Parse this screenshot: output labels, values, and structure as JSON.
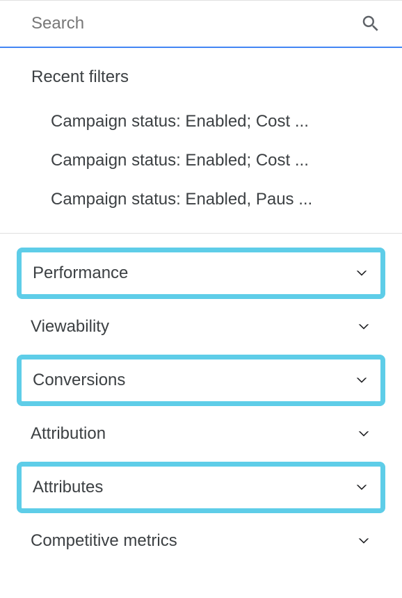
{
  "search": {
    "placeholder": "Search"
  },
  "recent": {
    "title": "Recent filters",
    "items": [
      "Campaign status: Enabled; Cost ...",
      "Campaign status: Enabled; Cost ...",
      "Campaign status: Enabled, Paus ..."
    ]
  },
  "categories": [
    {
      "label": "Performance",
      "highlighted": true
    },
    {
      "label": "Viewability",
      "highlighted": false
    },
    {
      "label": "Conversions",
      "highlighted": true
    },
    {
      "label": "Attribution",
      "highlighted": false
    },
    {
      "label": "Attributes",
      "highlighted": true
    },
    {
      "label": "Competitive metrics",
      "highlighted": false
    }
  ]
}
